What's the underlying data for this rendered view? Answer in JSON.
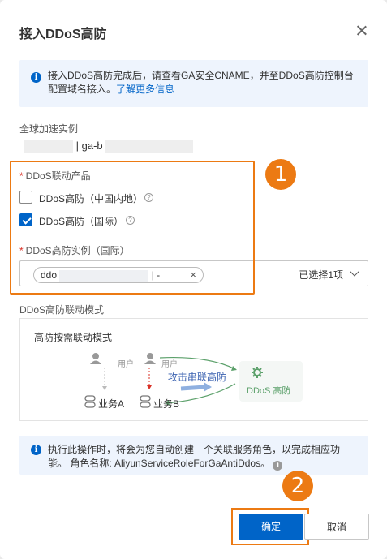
{
  "dialog": {
    "title": "接入DDoS高防"
  },
  "notice_top": {
    "text": "接入DDoS高防完成后，请查看GA安全CNAME，并至DDoS高防控制台配置域名接入。",
    "link": "了解更多信息"
  },
  "instance": {
    "label": "全球加速实例",
    "value": "| ga-b"
  },
  "linked_product": {
    "label": "DDoS联动产品",
    "options": [
      {
        "label": "DDoS高防（中国内地）",
        "checked": false
      },
      {
        "label": "DDoS高防（国际）",
        "checked": true
      }
    ]
  },
  "ddos_instance": {
    "label": "DDoS高防实例（国际）",
    "tag_prefix": "ddo",
    "tag_suffix": "| -",
    "tag_close": "×",
    "selected_count": "已选择1项"
  },
  "mode": {
    "label": "DDoS高防联动模式",
    "diagram_title": "高防按需联动模式",
    "user_label_1": "用户",
    "user_label_2": "用户",
    "business_a": "业务A",
    "business_b": "业务B",
    "attack_label": "攻击串联高防",
    "ddos_label": "DDoS 高防"
  },
  "notice_bottom": {
    "text": "执行此操作时，将会为您自动创建一个关联服务角色，以完成相应功能。 角色名称: AliyunServiceRoleForGaAntiDdos。"
  },
  "annotations": {
    "badge_1": "1",
    "badge_2": "2"
  },
  "footer": {
    "confirm": "确定",
    "cancel": "取消"
  },
  "colors": {
    "primary": "#0064c8",
    "highlight": "#ec7a13",
    "info_bg": "#eef4fd",
    "required": "#d93026"
  }
}
